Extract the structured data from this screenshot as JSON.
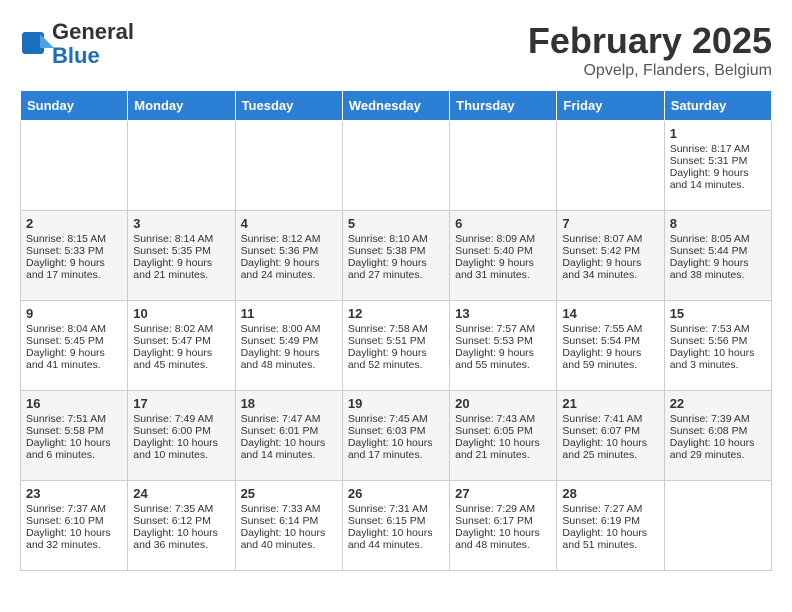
{
  "header": {
    "logo_line1": "General",
    "logo_line2": "Blue",
    "month": "February 2025",
    "location": "Opvelp, Flanders, Belgium"
  },
  "days_of_week": [
    "Sunday",
    "Monday",
    "Tuesday",
    "Wednesday",
    "Thursday",
    "Friday",
    "Saturday"
  ],
  "weeks": [
    [
      {
        "day": "",
        "info": ""
      },
      {
        "day": "",
        "info": ""
      },
      {
        "day": "",
        "info": ""
      },
      {
        "day": "",
        "info": ""
      },
      {
        "day": "",
        "info": ""
      },
      {
        "day": "",
        "info": ""
      },
      {
        "day": "1",
        "info": "Sunrise: 8:17 AM\nSunset: 5:31 PM\nDaylight: 9 hours and 14 minutes."
      }
    ],
    [
      {
        "day": "2",
        "info": "Sunrise: 8:15 AM\nSunset: 5:33 PM\nDaylight: 9 hours and 17 minutes."
      },
      {
        "day": "3",
        "info": "Sunrise: 8:14 AM\nSunset: 5:35 PM\nDaylight: 9 hours and 21 minutes."
      },
      {
        "day": "4",
        "info": "Sunrise: 8:12 AM\nSunset: 5:36 PM\nDaylight: 9 hours and 24 minutes."
      },
      {
        "day": "5",
        "info": "Sunrise: 8:10 AM\nSunset: 5:38 PM\nDaylight: 9 hours and 27 minutes."
      },
      {
        "day": "6",
        "info": "Sunrise: 8:09 AM\nSunset: 5:40 PM\nDaylight: 9 hours and 31 minutes."
      },
      {
        "day": "7",
        "info": "Sunrise: 8:07 AM\nSunset: 5:42 PM\nDaylight: 9 hours and 34 minutes."
      },
      {
        "day": "8",
        "info": "Sunrise: 8:05 AM\nSunset: 5:44 PM\nDaylight: 9 hours and 38 minutes."
      }
    ],
    [
      {
        "day": "9",
        "info": "Sunrise: 8:04 AM\nSunset: 5:45 PM\nDaylight: 9 hours and 41 minutes."
      },
      {
        "day": "10",
        "info": "Sunrise: 8:02 AM\nSunset: 5:47 PM\nDaylight: 9 hours and 45 minutes."
      },
      {
        "day": "11",
        "info": "Sunrise: 8:00 AM\nSunset: 5:49 PM\nDaylight: 9 hours and 48 minutes."
      },
      {
        "day": "12",
        "info": "Sunrise: 7:58 AM\nSunset: 5:51 PM\nDaylight: 9 hours and 52 minutes."
      },
      {
        "day": "13",
        "info": "Sunrise: 7:57 AM\nSunset: 5:53 PM\nDaylight: 9 hours and 55 minutes."
      },
      {
        "day": "14",
        "info": "Sunrise: 7:55 AM\nSunset: 5:54 PM\nDaylight: 9 hours and 59 minutes."
      },
      {
        "day": "15",
        "info": "Sunrise: 7:53 AM\nSunset: 5:56 PM\nDaylight: 10 hours and 3 minutes."
      }
    ],
    [
      {
        "day": "16",
        "info": "Sunrise: 7:51 AM\nSunset: 5:58 PM\nDaylight: 10 hours and 6 minutes."
      },
      {
        "day": "17",
        "info": "Sunrise: 7:49 AM\nSunset: 6:00 PM\nDaylight: 10 hours and 10 minutes."
      },
      {
        "day": "18",
        "info": "Sunrise: 7:47 AM\nSunset: 6:01 PM\nDaylight: 10 hours and 14 minutes."
      },
      {
        "day": "19",
        "info": "Sunrise: 7:45 AM\nSunset: 6:03 PM\nDaylight: 10 hours and 17 minutes."
      },
      {
        "day": "20",
        "info": "Sunrise: 7:43 AM\nSunset: 6:05 PM\nDaylight: 10 hours and 21 minutes."
      },
      {
        "day": "21",
        "info": "Sunrise: 7:41 AM\nSunset: 6:07 PM\nDaylight: 10 hours and 25 minutes."
      },
      {
        "day": "22",
        "info": "Sunrise: 7:39 AM\nSunset: 6:08 PM\nDaylight: 10 hours and 29 minutes."
      }
    ],
    [
      {
        "day": "23",
        "info": "Sunrise: 7:37 AM\nSunset: 6:10 PM\nDaylight: 10 hours and 32 minutes."
      },
      {
        "day": "24",
        "info": "Sunrise: 7:35 AM\nSunset: 6:12 PM\nDaylight: 10 hours and 36 minutes."
      },
      {
        "day": "25",
        "info": "Sunrise: 7:33 AM\nSunset: 6:14 PM\nDaylight: 10 hours and 40 minutes."
      },
      {
        "day": "26",
        "info": "Sunrise: 7:31 AM\nSunset: 6:15 PM\nDaylight: 10 hours and 44 minutes."
      },
      {
        "day": "27",
        "info": "Sunrise: 7:29 AM\nSunset: 6:17 PM\nDaylight: 10 hours and 48 minutes."
      },
      {
        "day": "28",
        "info": "Sunrise: 7:27 AM\nSunset: 6:19 PM\nDaylight: 10 hours and 51 minutes."
      },
      {
        "day": "",
        "info": ""
      }
    ]
  ]
}
